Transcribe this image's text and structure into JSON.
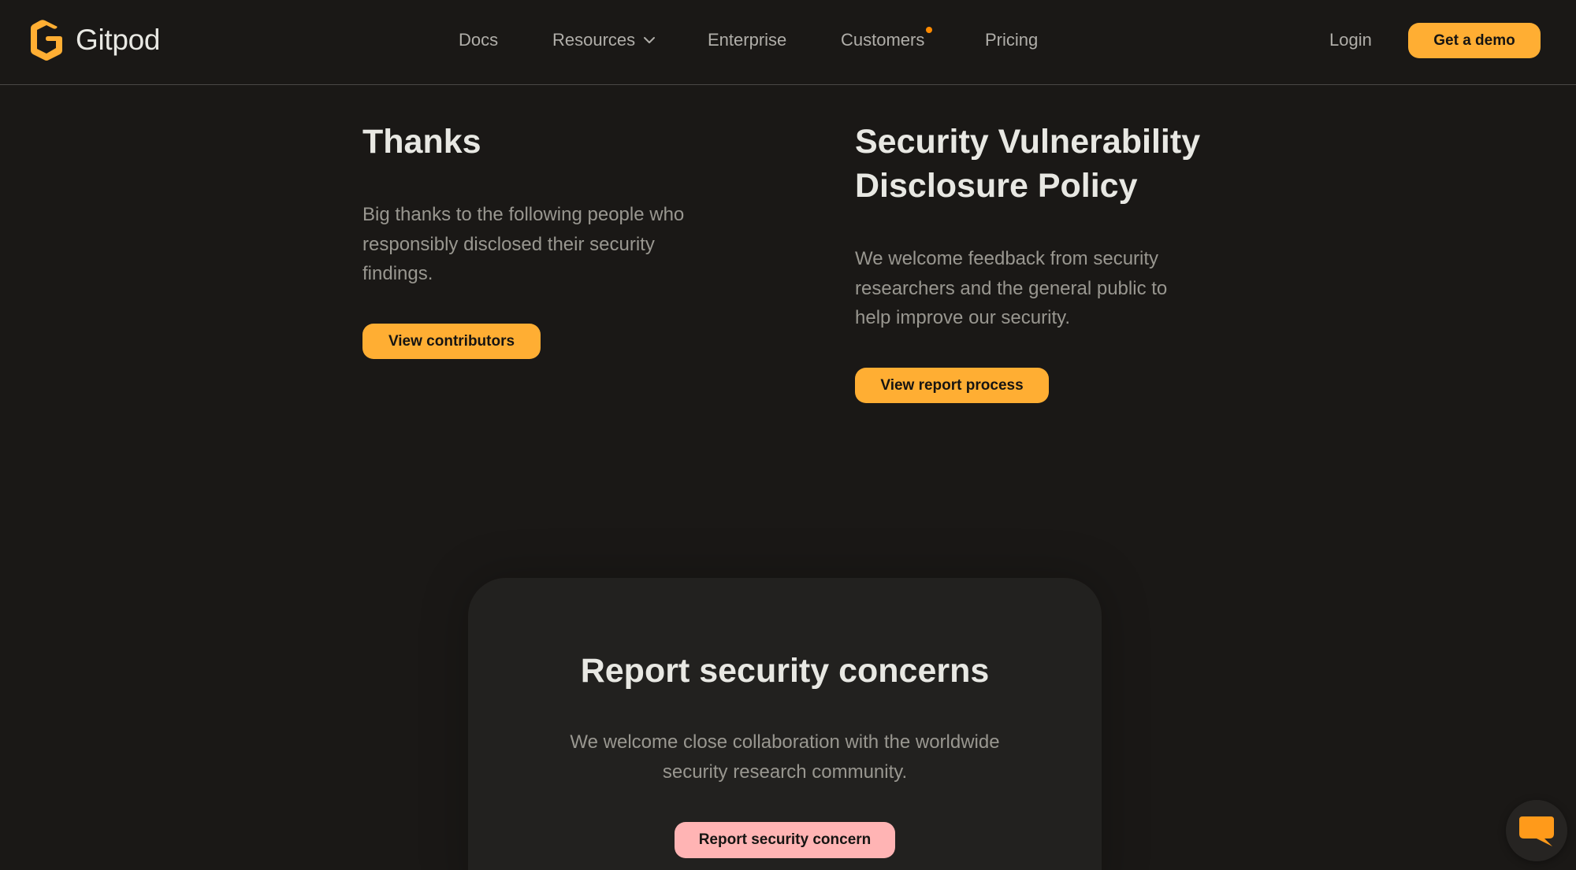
{
  "header": {
    "logo_text": "Gitpod",
    "nav": {
      "docs": "Docs",
      "resources": "Resources",
      "enterprise": "Enterprise",
      "customers": "Customers",
      "pricing": "Pricing"
    },
    "login": "Login",
    "demo_button": "Get a demo"
  },
  "thanks": {
    "title": "Thanks",
    "body": "Big thanks to the following people who responsibly disclosed their security findings.",
    "button": "View contributors"
  },
  "policy": {
    "title_line1": "Security Vulnerability",
    "title_line2": "Disclosure Policy",
    "body": "We welcome feedback from security researchers and the general public to help improve our security.",
    "button": "View report process"
  },
  "report": {
    "title": "Report security concerns",
    "body": "We welcome close collaboration with the worldwide security research community.",
    "button": "Report security concern"
  },
  "colors": {
    "background": "#1a1816",
    "accent": "#ffae33",
    "pink": "#ffb4b4",
    "notification_dot": "#ff8a00"
  },
  "icons": {
    "logo": "gitpod-logo-icon",
    "dropdown": "chevron-down-icon",
    "chat": "chat-bubble-icon"
  }
}
